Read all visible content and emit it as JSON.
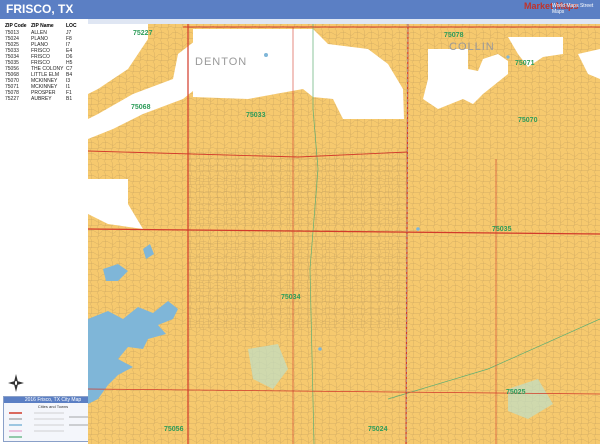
{
  "title": "FRISCO, TX",
  "logo": {
    "brand": "Market Maps",
    "sub": "World Maps Street Maps"
  },
  "zip_table": {
    "headers": [
      "ZIP Code",
      "ZIP Name",
      "LOC"
    ],
    "rows": [
      [
        "75013",
        "ALLEN",
        "J7"
      ],
      [
        "75024",
        "PLANO",
        "F8"
      ],
      [
        "75025",
        "PLANO",
        "I7"
      ],
      [
        "75033",
        "FRISCO",
        "E4"
      ],
      [
        "75034",
        "FRISCO",
        "D6"
      ],
      [
        "75035",
        "FRISCO",
        "H5"
      ],
      [
        "75056",
        "THE COLONY",
        "C7"
      ],
      [
        "75068",
        "LITTLE ELM",
        "B4"
      ],
      [
        "75070",
        "MCKINNEY",
        "I3"
      ],
      [
        "75071",
        "MCKINNEY",
        "I1"
      ],
      [
        "75078",
        "PROSPER",
        "F1"
      ],
      [
        "75227",
        "AUBREY",
        "B1"
      ]
    ]
  },
  "legend": {
    "title": "2016 Frisco, TX City Map",
    "subtitle": "Cities and Towns"
  },
  "counties": [
    "DENTON",
    "COLLIN"
  ],
  "zip_labels": [
    "75227",
    "75078",
    "75071",
    "75068",
    "75033",
    "75070",
    "75035",
    "75034",
    "75025",
    "75056",
    "75024"
  ],
  "colors": {
    "title_bar": "#5b7fc4",
    "land": "#f6c96e",
    "water": "#7fb6d8",
    "highway": "#d23a2a",
    "zip_label": "#2e9c5a",
    "county_label": "#9a9a9a"
  }
}
